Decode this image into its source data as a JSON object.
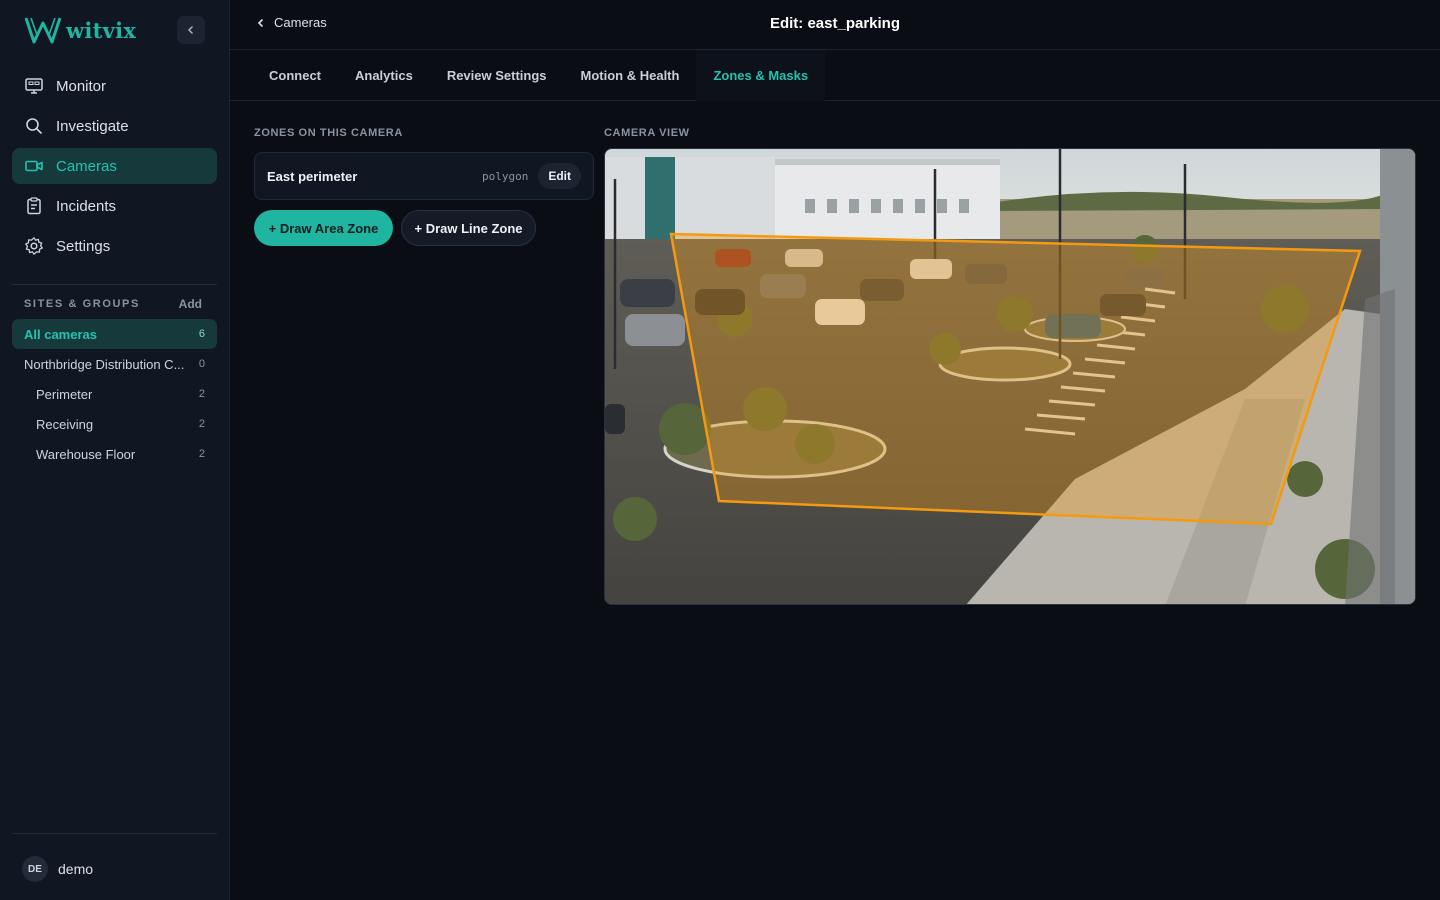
{
  "brand": {
    "name": "witvix",
    "accent": "#1fb5a0"
  },
  "nav": [
    {
      "label": "Monitor",
      "icon": "monitor-icon",
      "active": false
    },
    {
      "label": "Investigate",
      "icon": "search-icon",
      "active": false
    },
    {
      "label": "Cameras",
      "icon": "camera-icon",
      "active": true
    },
    {
      "label": "Incidents",
      "icon": "clipboard-icon",
      "active": false
    },
    {
      "label": "Settings",
      "icon": "gear-icon",
      "active": false
    }
  ],
  "sites": {
    "title": "SITES & GROUPS",
    "add_label": "Add",
    "groups": [
      {
        "name": "All cameras",
        "count": "6",
        "active": true,
        "child": false
      },
      {
        "name": "Northbridge Distribution C...",
        "count": "0",
        "active": false,
        "child": false
      },
      {
        "name": "Perimeter",
        "count": "2",
        "active": false,
        "child": true
      },
      {
        "name": "Receiving",
        "count": "2",
        "active": false,
        "child": true
      },
      {
        "name": "Warehouse Floor",
        "count": "2",
        "active": false,
        "child": true
      }
    ]
  },
  "user": {
    "initials": "DE",
    "name": "demo"
  },
  "header": {
    "back_label": "Cameras",
    "title": "Edit: east_parking"
  },
  "tabs": [
    {
      "label": "Connect",
      "active": false
    },
    {
      "label": "Analytics",
      "active": false
    },
    {
      "label": "Review Settings",
      "active": false
    },
    {
      "label": "Motion & Health",
      "active": false
    },
    {
      "label": "Zones & Masks",
      "active": true
    }
  ],
  "zones": {
    "section_label": "ZONES ON THIS CAMERA",
    "items": [
      {
        "name": "East perimeter",
        "type": "polygon",
        "edit_label": "Edit"
      }
    ],
    "draw_area_label": "+ Draw Area Zone",
    "draw_line_label": "+ Draw Line Zone"
  },
  "camera": {
    "section_label": "CAMERA VIEW",
    "zone_color": "#f39a12"
  }
}
